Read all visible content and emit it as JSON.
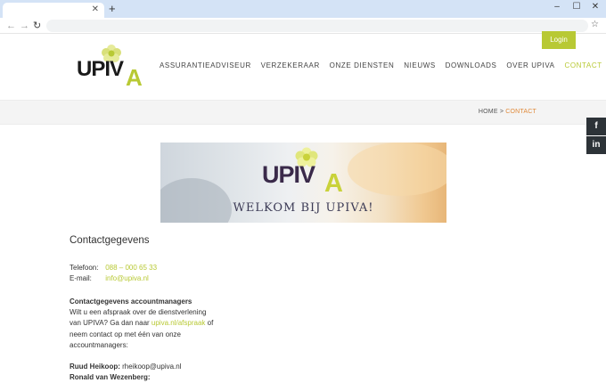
{
  "browser": {
    "window_controls": [
      "–",
      "☐",
      "✕"
    ],
    "close_tab": "✕",
    "new_tab": "+"
  },
  "header": {
    "login_label": "Login",
    "logo_text": "UPIVA",
    "nav": [
      {
        "label": "ASSURANTIEADVISEUR",
        "active": false
      },
      {
        "label": "VERZEKERAAR",
        "active": false
      },
      {
        "label": "ONZE DIENSTEN",
        "active": false
      },
      {
        "label": "NIEUWS",
        "active": false
      },
      {
        "label": "DOWNLOADS",
        "active": false
      },
      {
        "label": "OVER UPIVA",
        "active": false
      },
      {
        "label": "CONTACT",
        "active": true
      }
    ]
  },
  "breadcrumb": {
    "home": "HOME",
    "separator": " > ",
    "current": "CONTACT"
  },
  "social": {
    "facebook": "f",
    "linkedin": "in"
  },
  "banner": {
    "text": "WELKOM BIJ UPIVA!"
  },
  "contact": {
    "heading": "Contactgegevens",
    "phone_label": "Telefoon:",
    "phone_value": "088 – 000 65 33",
    "email_label": "E-mail:",
    "email_value": "info@upiva.nl",
    "managers_heading": "Contactgegevens accountmanagers",
    "managers_text_1": "Wilt u een afspraak over de dienstverlening",
    "managers_text_2a": "van UPIVA? Ga dan naar ",
    "managers_link": "upiva.nl/afspraak",
    "managers_text_2b": " of",
    "managers_text_3": "neem contact op met één van onze",
    "managers_text_4": "accountmanagers:",
    "person1_name": "Ruud Heikoop:",
    "person1_email": " rheikoop@upiva.nl",
    "person2_name": "Ronald van Wezenberg:"
  },
  "colors": {
    "accent_green": "#b8c934",
    "logo_purple": "#3a2a4a",
    "breadcrumb_current": "#e08a3a",
    "social_bg": "#2d3338"
  }
}
